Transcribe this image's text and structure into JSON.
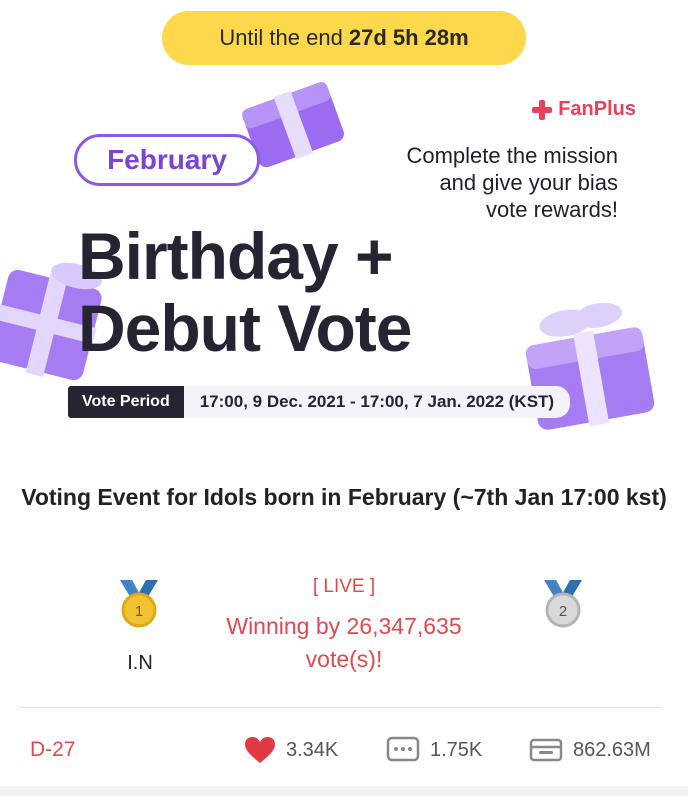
{
  "timer": {
    "prefix": "Until the end",
    "remaining": "27d 5h 28m"
  },
  "banner": {
    "brand": "FanPlus",
    "month": "February",
    "mission_lines": [
      "Complete the mission",
      "and give your bias",
      "vote rewards!"
    ],
    "headline_lines": [
      "Birthday +",
      "Debut Vote"
    ],
    "period_label": "Vote Period",
    "period_text": "17:00, 9 Dec. 2021 - 17:00, 7 Jan. 2022 (KST)"
  },
  "event": {
    "title": "Voting Event for Idols born in February (~7th Jan 17:00 kst)"
  },
  "ranking": {
    "first_place": {
      "rank": "1",
      "name": "I.N"
    },
    "second_place": {
      "rank": "2"
    },
    "live_label": "[ LIVE ]",
    "winning_text": "Winning by 26,347,635 vote(s)!"
  },
  "stats": {
    "dday": "D-27",
    "likes": "3.34K",
    "comments": "1.75K",
    "rewards": "862.63M"
  },
  "colors": {
    "accent_red": "#e0494e",
    "pill_yellow": "#fcd84a",
    "purple": "#8a5ae0",
    "brand_red": "#e8415a"
  },
  "icons": [
    "fanplus-logo-icon",
    "gift-box-icon",
    "medal-gold-icon",
    "medal-silver-icon",
    "heart-icon",
    "comment-icon",
    "wallet-icon"
  ]
}
